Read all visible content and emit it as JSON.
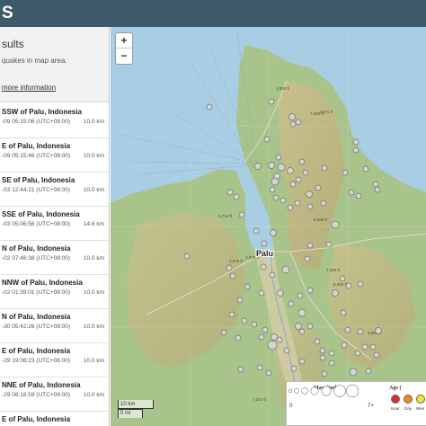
{
  "app": {
    "brand": "S"
  },
  "sidebar": {
    "title": "sults",
    "subtitle": "quakes in map area.",
    "more_info_link": "more information",
    "items": [
      {
        "place": "SSW of Palu, Indonesia",
        "time": "-09 05:15:06 (UTC+08:00)",
        "depth": "10.0 km"
      },
      {
        "place": "E of Palu, Indonesia",
        "time": "-09 05:15:46 (UTC+08:00)",
        "depth": "10.0 km"
      },
      {
        "place": "SE of Palu, Indonesia",
        "time": "-03 12:44:21 (UTC+08:00)",
        "depth": "10.0 km"
      },
      {
        "place": "SSE of Palu, Indonesia",
        "time": "-03 05:06:56 (UTC+08:00)",
        "depth": "14.6 km"
      },
      {
        "place": "N of Palu, Indonesia",
        "time": "-02 07:46:38 (UTC+08:00)",
        "depth": "10.0 km"
      },
      {
        "place": "NNW of Palu, Indonesia",
        "time": "-02 01:39:01 (UTC+08:00)",
        "depth": "10.0 km"
      },
      {
        "place": "N of Palu, Indonesia",
        "time": "-30 05:42:26 (UTC+08:00)",
        "depth": "10.0 km"
      },
      {
        "place": "E of Palu, Indonesia",
        "time": "-29 19:06:23 (UTC+08:00)",
        "depth": "10.0 km"
      },
      {
        "place": "NNE of Palu, Indonesia",
        "time": "-29 08:18:59 (UTC+08:00)",
        "depth": "10.0 km"
      },
      {
        "place": "E of Palu, Indonesia",
        "time": "",
        "depth": ""
      }
    ]
  },
  "map": {
    "zoom_in": "+",
    "zoom_out": "−",
    "city_label": "Palu",
    "scale_km": "10 km",
    "scale_mi": "5 mi",
    "elevation_labels": [
      "4,800 ft",
      "7,800 ft",
      "3,471 ft",
      "4,744 ft",
      "5,990 ft",
      "7,290 ft",
      "6,900 ft",
      "3,875 ft",
      "3,876 ft",
      "4,885 ft",
      "7,210 ft"
    ],
    "colors": {
      "water": "#a9cde2",
      "land": "#a9c48a",
      "mountain": "#c9b58a",
      "marker_fill": "#d9d9d9",
      "marker_stroke": "#6f6f6f"
    }
  },
  "legend": {
    "magnitude_title": "Magnitude",
    "mag_min": "0",
    "mag_max": "7+",
    "age_title": "Age (",
    "age_items": [
      {
        "label": "Hour",
        "color": "#d92b2b"
      },
      {
        "label": "Day",
        "color": "#ef8a1f"
      },
      {
        "label": "Wee",
        "color": "#f3e23a"
      }
    ]
  }
}
